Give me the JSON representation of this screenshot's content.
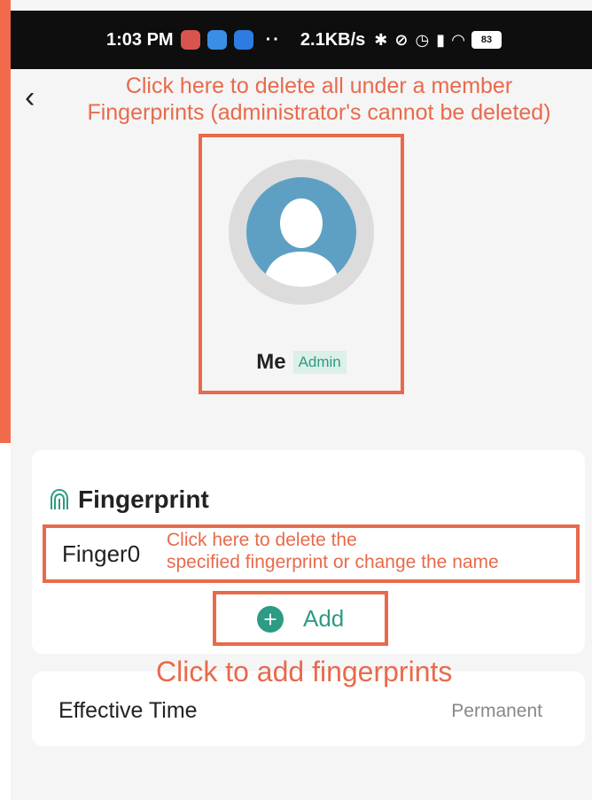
{
  "status_bar": {
    "time": "1:03 PM",
    "dots": "··",
    "net_speed": "2.1KB/s",
    "battery": "83"
  },
  "annotations": {
    "profile_line1": "Click here to delete all under a member",
    "profile_line2": "Fingerprints (administrator's cannot be deleted)",
    "finger_line1": "Click here to delete the",
    "finger_line2": "specified fingerprint or change the name",
    "add": "Click to add fingerprints"
  },
  "member": {
    "name": "Me",
    "role_badge": "Admin"
  },
  "fingerprint_section": {
    "title": "Fingerprint",
    "items": [
      {
        "name": "Finger0"
      }
    ],
    "add_label": "Add"
  },
  "effective_time": {
    "label": "Effective Time",
    "value": "Permanent"
  },
  "colors": {
    "annotation": "#e86a4c",
    "accent": "#2e9b84",
    "avatar_bg": "#5ea0c4",
    "page_bg": "#f5f5f5"
  }
}
